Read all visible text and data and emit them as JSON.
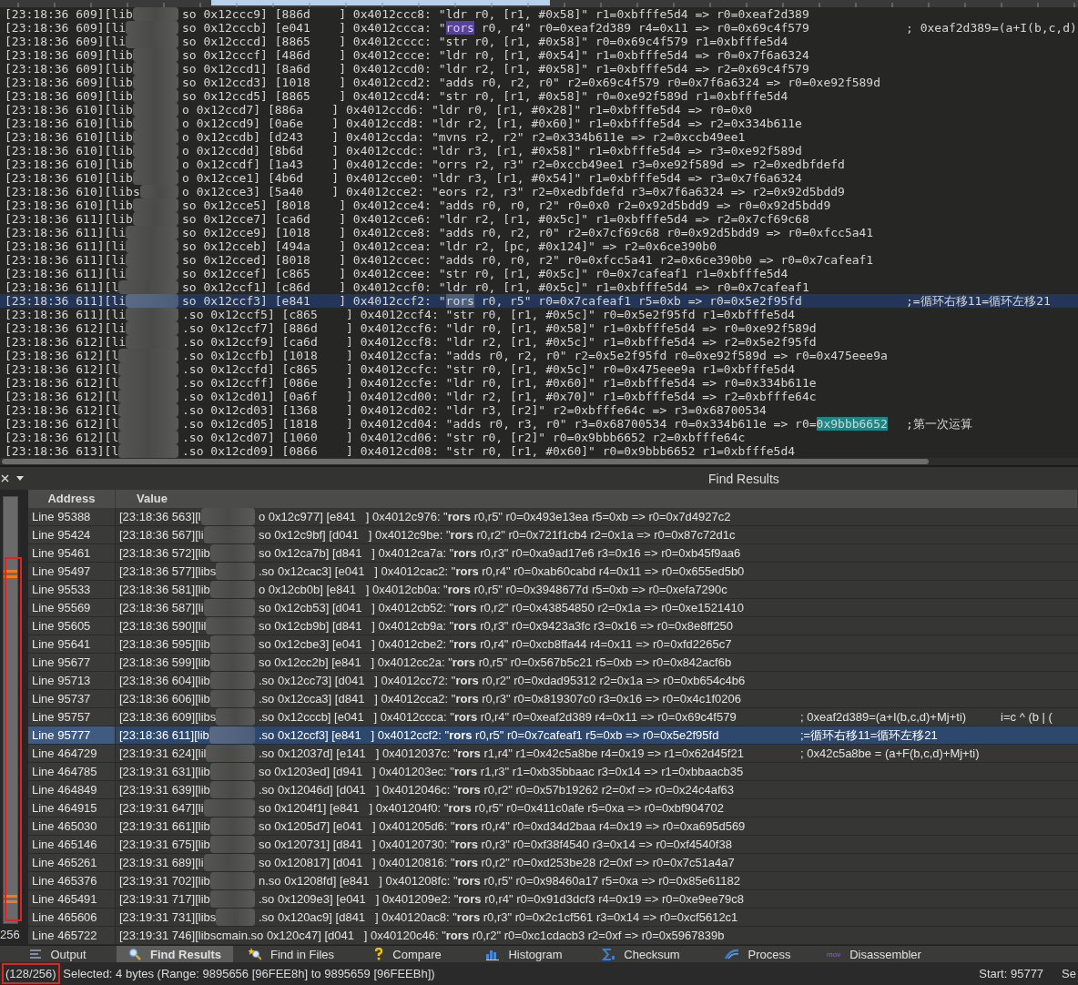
{
  "trace": {
    "rows": [
      {
        "prefix": "[23:18:36 609][lib",
        "parts": [
          {
            "text": "so 0x12ccc9] [886d    ] 0x4012ccc8: \"ldr r0, [r1, #0x58]\" r1=0xbfffe5d4 => r0=0xeaf2d389",
            "kind": "plain"
          }
        ],
        "selected": false
      },
      {
        "prefix": "[23:18:36 609][li",
        "parts": [
          {
            "text": "so 0x12cccb] [e041    ] 0x4012ccca: \"",
            "kind": "plain"
          },
          {
            "text": "rors",
            "kind": "search-hit"
          },
          {
            "text": " r0, r4\" r0=0xeaf2d389 r4=0x11 => r0=0x69c4f579",
            "kind": "plain"
          }
        ],
        "comment": "; 0xeaf2d389=(a+I(b,c,d)",
        "selected": false
      },
      {
        "prefix": "[23:18:36 609][li",
        "parts": [
          {
            "text": "so 0x12cccd] [8865    ] 0x4012cccc: \"str r0, [r1, #0x58]\" r0=0x69c4f579 r1=0xbfffe5d4",
            "kind": "plain"
          }
        ],
        "selected": false
      },
      {
        "prefix": "[23:18:36 609][lib",
        "parts": [
          {
            "text": "so 0x12cccf] [486d    ] 0x4012ccce: \"ldr r0, [r1, #0x54]\" r1=0xbfffe5d4 => r0=0x7f6a6324",
            "kind": "plain"
          }
        ],
        "selected": false
      },
      {
        "prefix": "[23:18:36 609][lib",
        "parts": [
          {
            "text": "so 0x12ccd1] [8a6d    ] 0x4012ccd0: \"ldr r2, [r1, #0x58]\" r1=0xbfffe5d4 => r2=0x69c4f579",
            "kind": "plain"
          }
        ],
        "selected": false
      },
      {
        "prefix": "[23:18:36 609][lib",
        "parts": [
          {
            "text": "so 0x12ccd3] [1018    ] 0x4012ccd2: \"adds r0, r2, r0\" r2=0x69c4f579 r0=0x7f6a6324 => r0=0xe92f589d",
            "kind": "plain"
          }
        ],
        "selected": false
      },
      {
        "prefix": "[23:18:36 609][lib",
        "parts": [
          {
            "text": "so 0x12ccd5] [8865    ] 0x4012ccd4: \"str r0, [r1, #0x58]\" r0=0xe92f589d r1=0xbfffe5d4",
            "kind": "plain"
          }
        ],
        "selected": false
      },
      {
        "prefix": "[23:18:36 610][lib",
        "parts": [
          {
            "text": "o 0x12ccd7] [886a    ] 0x4012ccd6: \"ldr r0, [r1, #0x28]\" r1=0xbfffe5d4 => r0=0x0",
            "kind": "plain"
          }
        ],
        "selected": false
      },
      {
        "prefix": "[23:18:36 610][lib",
        "parts": [
          {
            "text": "o 0x12ccd9] [0a6e    ] 0x4012ccd8: \"ldr r2, [r1, #0x60]\" r1=0xbfffe5d4 => r2=0x334b611e",
            "kind": "plain"
          }
        ],
        "selected": false
      },
      {
        "prefix": "[23:18:36 610][lib",
        "parts": [
          {
            "text": "o 0x12ccdb] [d243    ] 0x4012ccda: \"mvns r2, r2\" r2=0x334b611e => r2=0xccb49ee1",
            "kind": "plain"
          }
        ],
        "selected": false
      },
      {
        "prefix": "[23:18:36 610][lib",
        "parts": [
          {
            "text": "o 0x12ccdd] [8b6d    ] 0x4012ccdc: \"ldr r3, [r1, #0x58]\" r1=0xbfffe5d4 => r3=0xe92f589d",
            "kind": "plain"
          }
        ],
        "selected": false
      },
      {
        "prefix": "[23:18:36 610][lib",
        "parts": [
          {
            "text": "o 0x12ccdf] [1a43    ] 0x4012ccde: \"orrs r2, r3\" r2=0xccb49ee1 r3=0xe92f589d => r2=0xedbfdefd",
            "kind": "plain"
          }
        ],
        "selected": false
      },
      {
        "prefix": "[23:18:36 610][lib",
        "parts": [
          {
            "text": "o 0x12cce1] [4b6d    ] 0x4012cce0: \"ldr r3, [r1, #0x54]\" r1=0xbfffe5d4 => r3=0x7f6a6324",
            "kind": "plain"
          }
        ],
        "selected": false
      },
      {
        "prefix": "[23:18:36 610][libs",
        "parts": [
          {
            "text": "o 0x12cce3] [5a40    ] 0x4012cce2: \"eors r2, r3\" r2=0xedbfdefd r3=0x7f6a6324 => r2=0x92d5bdd9",
            "kind": "plain"
          }
        ],
        "selected": false
      },
      {
        "prefix": "[23:18:36 610][lib",
        "parts": [
          {
            "text": "so 0x12cce5] [8018    ] 0x4012cce4: \"adds r0, r0, r2\" r0=0x0 r2=0x92d5bdd9 => r0=0x92d5bdd9",
            "kind": "plain"
          }
        ],
        "selected": false
      },
      {
        "prefix": "[23:18:36 611][lib",
        "parts": [
          {
            "text": "so 0x12cce7] [ca6d    ] 0x4012cce6: \"ldr r2, [r1, #0x5c]\" r1=0xbfffe5d4 => r2=0x7cf69c68",
            "kind": "plain"
          }
        ],
        "selected": false
      },
      {
        "prefix": "[23:18:36 611][li",
        "parts": [
          {
            "text": "so 0x12cce9] [1018    ] 0x4012cce8: \"adds r0, r2, r0\" r2=0x7cf69c68 r0=0x92d5bdd9 => r0=0xfcc5a41",
            "kind": "plain"
          }
        ],
        "selected": false
      },
      {
        "prefix": "[23:18:36 611][li",
        "parts": [
          {
            "text": "so 0x12cceb] [494a    ] 0x4012ccea: \"ldr r2, [pc, #0x124]\" => r2=0x6ce390b0",
            "kind": "plain"
          }
        ],
        "selected": false
      },
      {
        "prefix": "[23:18:36 611][li",
        "parts": [
          {
            "text": "so 0x12cced] [8018    ] 0x4012ccec: \"adds r0, r0, r2\" r0=0xfcc5a41 r2=0x6ce390b0 => r0=0x7cafeaf1",
            "kind": "plain"
          }
        ],
        "selected": false
      },
      {
        "prefix": "[23:18:36 611][li",
        "parts": [
          {
            "text": "so 0x12ccef] [c865    ] 0x4012ccee: \"str r0, [r1, #0x5c]\" r0=0x7cafeaf1 r1=0xbfffe5d4",
            "kind": "plain"
          }
        ],
        "selected": false
      },
      {
        "prefix": "[23:18:36 611][l",
        "parts": [
          {
            "text": "so 0x12ccf1] [c86d    ] 0x4012ccf0: \"ldr r0, [r1, #0x5c]\" r1=0xbfffe5d4 => r0=0x7cafeaf1",
            "kind": "plain"
          }
        ],
        "selected": false
      },
      {
        "prefix": "[23:18:36 611][li",
        "parts": [
          {
            "text": "so 0x12ccf3] [e841    ] 0x4012ccf2: \"",
            "kind": "plain"
          },
          {
            "text": "rors",
            "kind": "current-hit"
          },
          {
            "text": " r0, r5\" r0=0x7cafeaf1 r5=0xb => r0=0x5e2f95fd",
            "kind": "plain"
          }
        ],
        "comment": ";=循环右移11=循环左移21",
        "selected": true
      },
      {
        "prefix": "[23:18:36 611][li",
        "parts": [
          {
            "text": ".so 0x12ccf5] [c865    ] 0x4012ccf4: \"str r0, [r1, #0x5c]\" r0=0x5e2f95fd r1=0xbfffe5d4",
            "kind": "plain"
          }
        ],
        "selected": false
      },
      {
        "prefix": "[23:18:36 612][li",
        "parts": [
          {
            "text": ".so 0x12ccf7] [886d    ] 0x4012ccf6: \"ldr r0, [r1, #0x58]\" r1=0xbfffe5d4 => r0=0xe92f589d",
            "kind": "plain"
          }
        ],
        "selected": false
      },
      {
        "prefix": "[23:18:36 612][li",
        "parts": [
          {
            "text": ".so 0x12ccf9] [ca6d    ] 0x4012ccf8: \"ldr r2, [r1, #0x5c]\" r1=0xbfffe5d4 => r2=0x5e2f95fd",
            "kind": "plain"
          }
        ],
        "selected": false
      },
      {
        "prefix": "[23:18:36 612][l",
        "parts": [
          {
            "text": ".so 0x12ccfb] [1018    ] 0x4012ccfa: \"adds r0, r2, r0\" r2=0x5e2f95fd r0=0xe92f589d => r0=0x475eee9a",
            "kind": "plain"
          }
        ],
        "selected": false
      },
      {
        "prefix": "[23:18:36 612][l",
        "parts": [
          {
            "text": ".so 0x12ccfd] [c865    ] 0x4012ccfc: \"str r0, [r1, #0x5c]\" r0=0x475eee9a r1=0xbfffe5d4",
            "kind": "plain"
          }
        ],
        "selected": false
      },
      {
        "prefix": "[23:18:36 612][l",
        "parts": [
          {
            "text": ".so 0x12ccff] [086e    ] 0x4012ccfe: \"ldr r0, [r1, #0x60]\" r1=0xbfffe5d4 => r0=0x334b611e",
            "kind": "plain"
          }
        ],
        "selected": false
      },
      {
        "prefix": "[23:18:36 612][l",
        "parts": [
          {
            "text": ".so 0x12cd01] [0a6f    ] 0x4012cd00: \"ldr r2, [r1, #0x70]\" r1=0xbfffe5d4 => r2=0xbfffe64c",
            "kind": "plain"
          }
        ],
        "selected": false
      },
      {
        "prefix": "[23:18:36 612][l",
        "parts": [
          {
            "text": ".so 0x12cd03] [1368    ] 0x4012cd02: \"ldr r3, [r2]\" r2=0xbfffe64c => r3=0x68700534",
            "kind": "plain"
          }
        ],
        "selected": false
      },
      {
        "prefix": "[23:18:36 612][l",
        "parts": [
          {
            "text": ".so 0x12cd05] [1818    ] 0x4012cd04: \"adds r0, r3, r0\" r3=0x68700534 r0=0x334b611e => r0=",
            "kind": "plain"
          },
          {
            "text": "0x9bbb6652",
            "kind": "selection"
          }
        ],
        "comment": ";第一次运算",
        "selected": false
      },
      {
        "prefix": "[23:18:36 612][l",
        "parts": [
          {
            "text": ".so 0x12cd07] [1060    ] 0x4012cd06: \"str r0, [r2]\" r0=0x9bbb6652 r2=0xbfffe64c",
            "kind": "plain"
          }
        ],
        "selected": false
      },
      {
        "prefix": "[23:18:36 613][l",
        "parts": [
          {
            "text": ".so 0x12cd09] [0866    ] 0x4012cd08: \"str r0, [r1, #0x60]\" r0=0x9bbb6652 r1=0xbfffe5d4",
            "kind": "plain"
          }
        ],
        "selected": false
      }
    ]
  },
  "find_results": {
    "title": "Find Results",
    "overview": {
      "annotated": true,
      "count_label": "256"
    },
    "columns": [
      "Address",
      "Value"
    ],
    "rows": [
      {
        "address": "Line 95388",
        "redacted": true,
        "prefix": "[23:18:36 563][l",
        "rest": "o 0x12c977] [e841   ] 0x4012c976: \"**rors** r0,r5\" r0=0x493e13ea r5=0xb => r0=0x7d4927c2",
        "selected": false
      },
      {
        "address": "Line 95424",
        "redacted": true,
        "prefix": "[23:18:36 567][li",
        "rest": "so 0x12c9bf] [d041   ] 0x4012c9be: \"**rors** r0,r2\" r0=0x721f1cb4 r2=0x1a => r0=0x87c72d1c",
        "selected": false
      },
      {
        "address": "Line 95461",
        "redacted": true,
        "prefix": "[23:18:36 572][lib",
        "rest": "so 0x12ca7b] [d841   ] 0x4012ca7a: \"**rors** r0,r3\" r0=0xa9ad17e6 r3=0x16 => r0=0xb45f9aa6",
        "selected": false
      },
      {
        "address": "Line 95497",
        "redacted": true,
        "prefix": "[23:18:36 577][libs",
        "rest": ".so 0x12cac3] [e041   ] 0x4012cac2: \"**rors** r0,r4\" r0=0xab60cabd r4=0x11 => r0=0x655ed5b0",
        "selected": false
      },
      {
        "address": "Line 95533",
        "redacted": true,
        "prefix": "[23:18:36 581][lib",
        "rest": "o 0x12cb0b] [e841   ] 0x4012cb0a: \"**rors** r0,r5\" r0=0x3948677d r5=0xb => r0=0xefa7290c",
        "selected": false
      },
      {
        "address": "Line 95569",
        "redacted": true,
        "prefix": "[23:18:36 587][li",
        "rest": "so 0x12cb53] [d041   ] 0x4012cb52: \"**rors** r0,r2\" r0=0x43854850 r2=0x1a => r0=0xe1521410",
        "selected": false
      },
      {
        "address": "Line 95605",
        "redacted": true,
        "prefix": "[23:18:36 590][lil",
        "rest": "so 0x12cb9b] [d841   ] 0x4012cb9a: \"**rors** r0,r3\" r0=0x9423a3fc r3=0x16 => r0=0x8e8ff250",
        "selected": false
      },
      {
        "address": "Line 95641",
        "redacted": true,
        "prefix": "[23:18:36 595][lib",
        "rest": "so 0x12cbe3] [e041   ] 0x4012cbe2: \"**rors** r0,r4\" r0=0xcb8ffa44 r4=0x11 => r0=0xfd2265c7",
        "selected": false
      },
      {
        "address": "Line 95677",
        "redacted": true,
        "prefix": "[23:18:36 599][lib",
        "rest": "so 0x12cc2b] [e841   ] 0x4012cc2a: \"**rors** r0,r5\" r0=0x567b5c21 r5=0xb => r0=0x842acf6b",
        "selected": false
      },
      {
        "address": "Line 95713",
        "redacted": true,
        "prefix": "[23:18:36 604][lib",
        "rest": ".so 0x12cc73] [d041   ] 0x4012cc72: \"**rors** r0,r2\" r0=0xdad95312 r2=0x1a => r0=0xb654c4b6",
        "selected": false
      },
      {
        "address": "Line 95737",
        "redacted": true,
        "prefix": "[23:18:36 606][lib",
        "rest": ".so 0x12cca3] [d841   ] 0x4012cca2: \"**rors** r0,r3\" r0=0x819307c0 r3=0x16 => r0=0x4c1f0206",
        "selected": false
      },
      {
        "address": "Line 95757",
        "redacted": true,
        "prefix": "[23:18:36 609][libs",
        "rest": ".so 0x12cccb] [e041   ] 0x4012ccca: \"**rors** r0,r4\" r0=0xeaf2d389 r4=0x11 => r0=0x69c4f579",
        "comment": "; 0xeaf2d389=(a+I(b,c,d)+Mj+ti)",
        "note": "i=c ^ (b | (",
        "selected": false
      },
      {
        "address": "Line 95777",
        "redacted": true,
        "prefix": "[23:18:36 611][lib",
        "rest": ".so 0x12ccf3] [e841   ] 0x4012ccf2: \"**rors** r0,r5\" r0=0x7cafeaf1 r5=0xb => r0=0x5e2f95fd",
        "comment": ";=循环右移11=循环左移21",
        "selected": true
      },
      {
        "address": "Line 464729",
        "redacted": true,
        "prefix": "[23:19:31 624][lil",
        "rest": ".so 0x12037d] [e141   ] 0x4012037c: \"**rors** r1,r4\" r1=0x42c5a8be r4=0x19 => r1=0x62d45f21",
        "comment": "; 0x42c5a8be = (a+F(b,c,d)+Mj+ti)",
        "selected": false
      },
      {
        "address": "Line 464785",
        "redacted": true,
        "prefix": "[23:19:31 631][lib",
        "rest": "so 0x1203ed] [d941   ] 0x401203ec: \"**rors** r1,r3\" r1=0xb35bbaac r3=0x14 => r1=0xbbaacb35",
        "selected": false
      },
      {
        "address": "Line 464849",
        "redacted": true,
        "prefix": "[23:19:31 639][lib",
        "rest": ".so 0x12046d] [d041   ] 0x4012046c: \"**rors** r0,r2\" r0=0x57b19262 r2=0xf => r0=0x24c4af63",
        "selected": false
      },
      {
        "address": "Line 464915",
        "redacted": true,
        "prefix": "[23:19:31 647][li",
        "rest": "so 0x1204f1] [e841   ] 0x401204f0: \"**rors** r0,r5\" r0=0x411c0afe r5=0xa => r0=0xbf904702",
        "selected": false
      },
      {
        "address": "Line 465030",
        "redacted": true,
        "prefix": "[23:19:31 661][lib",
        "rest": "so 0x1205d7] [e041   ] 0x401205d6: \"**rors** r0,r4\" r0=0xd34d2baa r4=0x19 => r0=0xa695d569",
        "selected": false
      },
      {
        "address": "Line 465146",
        "redacted": true,
        "prefix": "[23:19:31 675][lib",
        "rest": "so 0x120731] [d841   ] 0x40120730: \"**rors** r0,r3\" r0=0xf38f4540 r3=0x14 => r0=0xf4540f38",
        "selected": false
      },
      {
        "address": "Line 465261",
        "redacted": true,
        "prefix": "[23:19:31 689][li",
        "rest": "so 0x120817] [d041   ] 0x40120816: \"**rors** r0,r2\" r0=0xd253be28 r2=0xf => r0=0x7c51a4a7",
        "selected": false
      },
      {
        "address": "Line 465376",
        "redacted": true,
        "prefix": "[23:19:31 702][lib",
        "rest": "n.so 0x1208fd] [e841   ] 0x401208fc: \"**rors** r0,r5\" r0=0x98460a17 r5=0xa => r0=0x85e61182",
        "selected": false
      },
      {
        "address": "Line 465491",
        "redacted": true,
        "prefix": "[23:19:31 717][lib",
        "rest": ".so 0x1209e3] [e041   ] 0x401209e2: \"**rors** r0,r4\" r0=0x91d3dcf3 r4=0x19 => r0=0xe9ee79c8",
        "selected": false
      },
      {
        "address": "Line 465606",
        "redacted": true,
        "prefix": "[23:19:31 731][libs",
        "rest": ".so 0x120ac9] [d841   ] 0x40120ac8: \"**rors** r0,r3\" r0=0x2c1cf561 r3=0x14 => r0=0xcf5612c1",
        "selected": false
      },
      {
        "address": "Line 465722",
        "redacted": false,
        "rest": "[23:19:31 746][libscmain.so 0x120c47] [d041   ] 0x40120c46: \"**rors** r0,r2\" r0=0xc1cdacb3 r2=0xf => r0=0x5967839b",
        "selected": false
      }
    ]
  },
  "tabs": [
    {
      "label": "Output",
      "kind": "output",
      "selected": false
    },
    {
      "label": "Find Results",
      "kind": "find",
      "selected": true
    },
    {
      "label": "Find in Files",
      "kind": "find-files",
      "selected": false
    },
    {
      "label": "Compare",
      "kind": "compare",
      "selected": false
    },
    {
      "label": "Histogram",
      "kind": "histogram",
      "selected": false
    },
    {
      "label": "Checksum",
      "kind": "checksum",
      "selected": false
    },
    {
      "label": "Process",
      "kind": "process",
      "selected": false
    },
    {
      "label": "Disassembler",
      "kind": "disassembler",
      "icon_text": "mov",
      "selected": false
    }
  ],
  "status_bar": {
    "count": "(128/256)",
    "count_annotated": true,
    "selection": "Selected: 4 bytes (Range: 9895656 [96FEE8h] to 9895659 [96FEEBh])",
    "start": "Start: 95777",
    "cut": "Se"
  }
}
